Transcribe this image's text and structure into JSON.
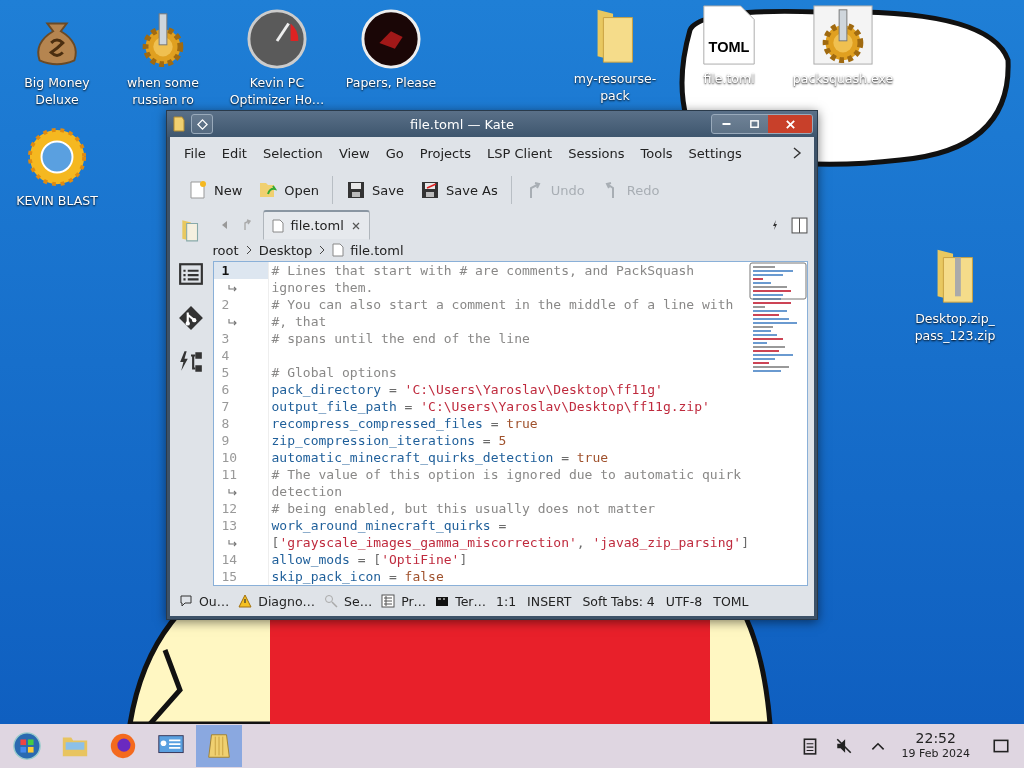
{
  "desktop": {
    "icons": [
      {
        "label": "Big Money Deluxe",
        "kind": "moneybag"
      },
      {
        "label": "when some russian ro",
        "kind": "gear"
      },
      {
        "label": "Kevin PC Optimizer Ho…",
        "kind": "gauge"
      },
      {
        "label": "Papers, Please",
        "kind": "seal"
      },
      {
        "label": "my-resourse-pack",
        "kind": "folder"
      },
      {
        "label": "file.toml",
        "kind": "document",
        "badge": "TOML"
      },
      {
        "label": "packsquash.exe",
        "kind": "program"
      },
      {
        "label": "KEVIN BLAST",
        "kind": "sun"
      },
      {
        "label": "Desktop.zip_ pass_123.zip",
        "kind": "zip"
      }
    ]
  },
  "window": {
    "title": "file.toml — Kate",
    "menu": [
      "File",
      "Edit",
      "Selection",
      "View",
      "Go",
      "Projects",
      "LSP Client",
      "Sessions",
      "Tools",
      "Settings"
    ],
    "toolbar": [
      {
        "label": "New",
        "kind": "new",
        "disabled": false
      },
      {
        "label": "Open",
        "kind": "open",
        "disabled": false
      },
      {
        "label": "Save",
        "kind": "save",
        "disabled": false
      },
      {
        "label": "Save As",
        "kind": "saveas",
        "disabled": false
      },
      {
        "label": "Undo",
        "kind": "undo",
        "disabled": true
      },
      {
        "label": "Redo",
        "kind": "redo",
        "disabled": true
      }
    ],
    "tab": {
      "label": "file.toml",
      "selected": true
    },
    "breadcrumb": [
      "root",
      "Desktop",
      "file.toml"
    ],
    "editor": {
      "rows": [
        {
          "kind": "line",
          "number": "1",
          "current": true,
          "tokens": [
            {
              "kind": "comment",
              "text": "# Lines that start with # are comments, and PackSquash"
            }
          ]
        },
        {
          "kind": "wrap",
          "tokens": [
            {
              "kind": "comment",
              "text": "ignores them."
            }
          ]
        },
        {
          "kind": "line",
          "number": "2",
          "current": false,
          "tokens": [
            {
              "kind": "comment",
              "text": "# You can also start a comment in the middle of a line with"
            }
          ]
        },
        {
          "kind": "wrap",
          "tokens": [
            {
              "kind": "comment",
              "text": "#, that"
            }
          ]
        },
        {
          "kind": "line",
          "number": "3",
          "current": false,
          "tokens": [
            {
              "kind": "comment",
              "text": "# spans until the end of the line"
            }
          ]
        },
        {
          "kind": "line",
          "number": "4",
          "current": false,
          "tokens": []
        },
        {
          "kind": "line",
          "number": "5",
          "current": false,
          "tokens": [
            {
              "kind": "comment",
              "text": "# Global options"
            }
          ]
        },
        {
          "kind": "line",
          "number": "6",
          "current": false,
          "tokens": [
            {
              "kind": "key",
              "text": "pack_directory"
            },
            {
              "kind": "op",
              "text": " = "
            },
            {
              "kind": "string",
              "text": "'C:\\Users\\Yaroslav\\Desktop\\ff11g'"
            }
          ]
        },
        {
          "kind": "line",
          "number": "7",
          "current": false,
          "tokens": [
            {
              "kind": "key",
              "text": "output_file_path"
            },
            {
              "kind": "op",
              "text": " = "
            },
            {
              "kind": "string",
              "text": "'C:\\Users\\Yaroslav\\Desktop\\ff11g.zip'"
            }
          ]
        },
        {
          "kind": "line",
          "number": "8",
          "current": false,
          "tokens": [
            {
              "kind": "key",
              "text": "recompress_compressed_files"
            },
            {
              "kind": "op",
              "text": " = "
            },
            {
              "kind": "value",
              "text": "true"
            }
          ]
        },
        {
          "kind": "line",
          "number": "9",
          "current": false,
          "tokens": [
            {
              "kind": "key",
              "text": "zip_compression_iterations"
            },
            {
              "kind": "op",
              "text": " = "
            },
            {
              "kind": "value",
              "text": "5"
            }
          ]
        },
        {
          "kind": "line",
          "number": "10",
          "current": false,
          "tokens": [
            {
              "kind": "key",
              "text": "automatic_minecraft_quirks_detection"
            },
            {
              "kind": "op",
              "text": " = "
            },
            {
              "kind": "value",
              "text": "true"
            }
          ]
        },
        {
          "kind": "line",
          "number": "11",
          "current": false,
          "tokens": [
            {
              "kind": "comment",
              "text": "# The value of this option is ignored due to automatic quirk"
            }
          ]
        },
        {
          "kind": "wrap",
          "tokens": [
            {
              "kind": "comment",
              "text": "detection"
            }
          ]
        },
        {
          "kind": "line",
          "number": "12",
          "current": false,
          "tokens": [
            {
              "kind": "comment",
              "text": "# being enabled, but this usually does not matter"
            }
          ]
        },
        {
          "kind": "line",
          "number": "13",
          "current": false,
          "tokens": [
            {
              "kind": "key",
              "text": "work_around_minecraft_quirks"
            },
            {
              "kind": "op",
              "text": " ="
            }
          ]
        },
        {
          "kind": "wrap",
          "tokens": [
            {
              "kind": "op",
              "text": "["
            },
            {
              "kind": "string",
              "text": "'grayscale_images_gamma_miscorrection'"
            },
            {
              "kind": "op",
              "text": ", "
            },
            {
              "kind": "string",
              "text": "'java8_zip_parsing'"
            },
            {
              "kind": "op",
              "text": "]"
            }
          ]
        },
        {
          "kind": "line",
          "number": "14",
          "current": false,
          "tokens": [
            {
              "kind": "key",
              "text": "allow_mods"
            },
            {
              "kind": "op",
              "text": " = ["
            },
            {
              "kind": "string",
              "text": "'OptiFine'"
            },
            {
              "kind": "op",
              "text": "]"
            }
          ]
        },
        {
          "kind": "line",
          "number": "15",
          "current": false,
          "tokens": [
            {
              "kind": "key",
              "text": "skip_pack_icon"
            },
            {
              "kind": "op",
              "text": " = "
            },
            {
              "kind": "value",
              "text": "false"
            }
          ]
        }
      ]
    },
    "status_bar": {
      "panels": [
        {
          "label": "Ou…",
          "kind": "output"
        },
        {
          "label": "Diagno…",
          "kind": "diagnostics"
        },
        {
          "label": "Se…",
          "kind": "search"
        },
        {
          "label": "Pr…",
          "kind": "project"
        },
        {
          "label": "Ter…",
          "kind": "terminal"
        }
      ],
      "items": [
        "1:1",
        "INSERT",
        "Soft Tabs: 4",
        "UTF-8",
        "TOML"
      ]
    }
  },
  "taskbar": {
    "apps": [
      {
        "kind": "start",
        "selected": false
      },
      {
        "kind": "folder",
        "selected": false
      },
      {
        "kind": "firefox",
        "selected": false
      },
      {
        "kind": "settings",
        "selected": false
      },
      {
        "kind": "kate",
        "selected": true
      }
    ],
    "time": "22:52",
    "date": "19 Feb 2024"
  }
}
